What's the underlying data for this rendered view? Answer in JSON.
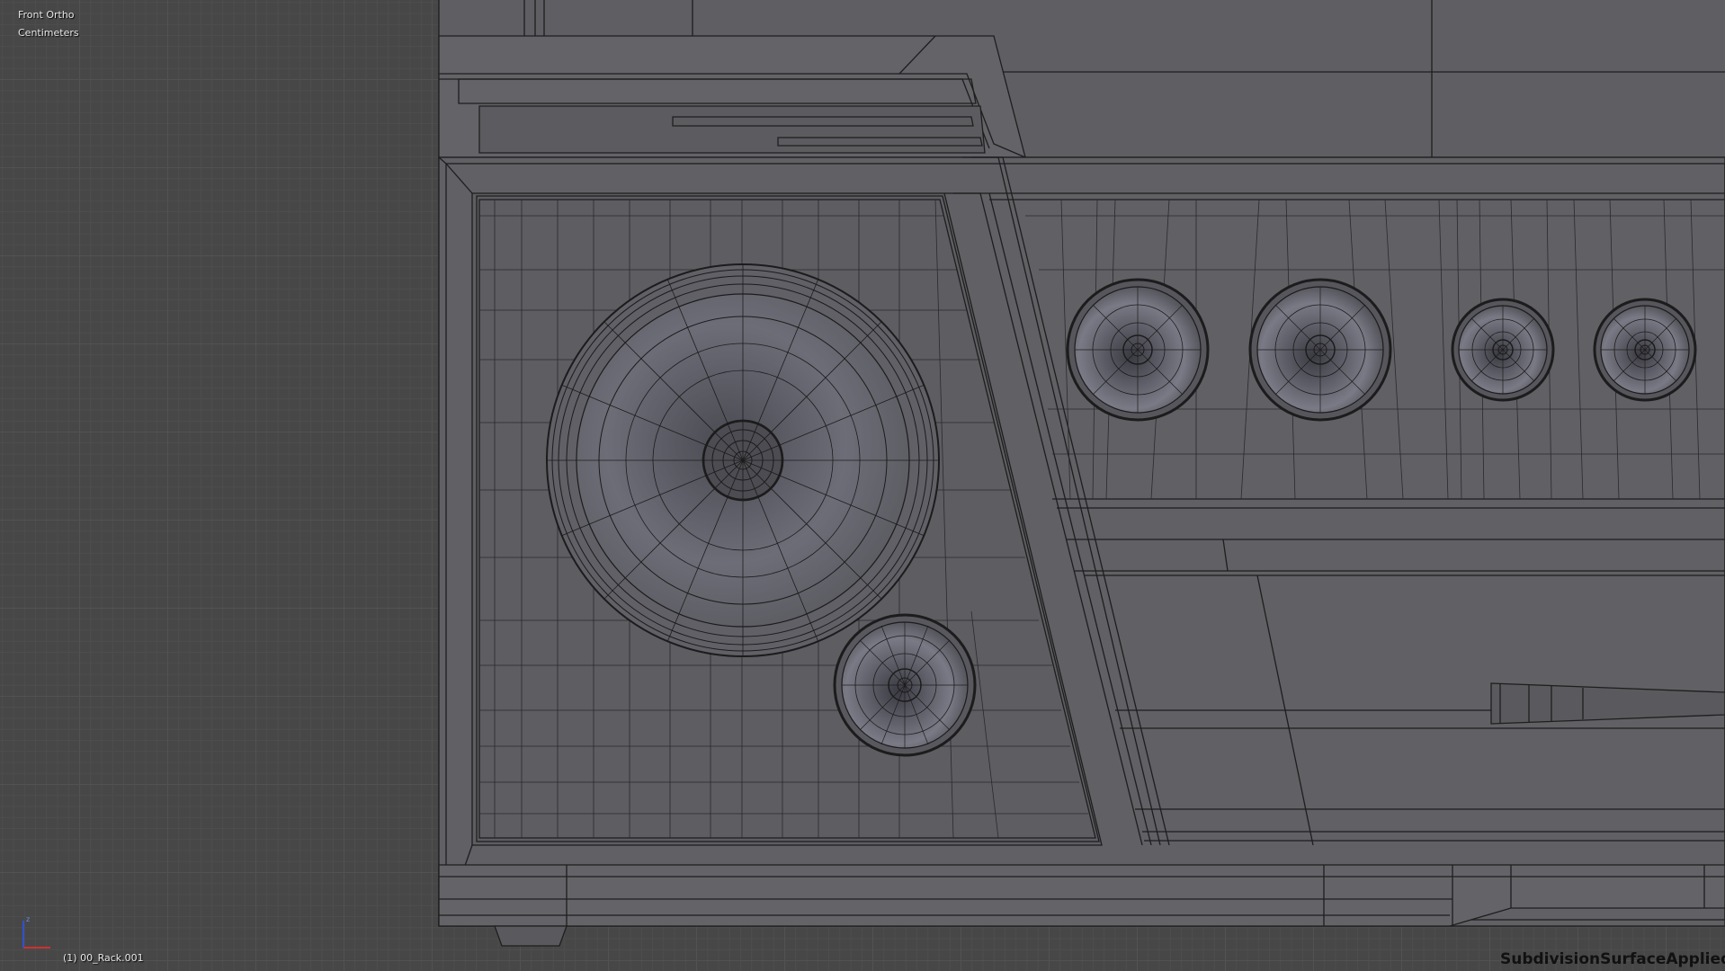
{
  "viewport": {
    "view_name": "Front Ortho",
    "units": "Centimeters",
    "object_name": "(1) 00_Rack.001",
    "modifier_label": "SubdivisionSurfaceApplied"
  },
  "axes": {
    "z_label": "z",
    "colors": {
      "x": "#d03030",
      "z": "#3050d0"
    }
  },
  "colors": {
    "grid_bg": "#474747",
    "mesh_fill": "#5f5f63",
    "wire": "#1e1e1e"
  }
}
